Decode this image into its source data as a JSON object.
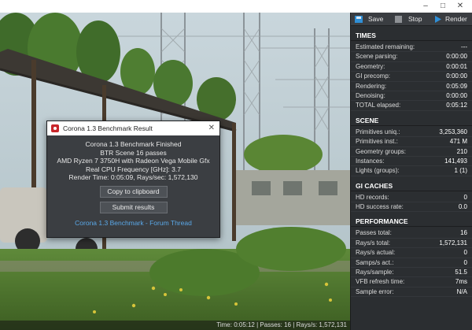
{
  "colors": {
    "panel_bg": "#2b2e31",
    "link": "#5aa8e8",
    "accent_red": "#c8262b",
    "render_blue": "#2f8fd6"
  },
  "toolbar": {
    "save_label": "Save",
    "stop_label": "Stop",
    "render_label": "Render"
  },
  "times": {
    "title": "TIMES",
    "rows": [
      {
        "k": "Estimated remaining:",
        "v": "---"
      },
      {
        "k": "Scene parsing:",
        "v": "0:00:00"
      },
      {
        "k": "Geometry:",
        "v": "0:00:01"
      },
      {
        "k": "GI precomp:",
        "v": "0:00:00"
      },
      {
        "k": "Rendering:",
        "v": "0:05:09"
      },
      {
        "k": "Denoising:",
        "v": "0:00:00"
      },
      {
        "k": "TOTAL elapsed:",
        "v": "0:05:12"
      }
    ]
  },
  "scene": {
    "title": "SCENE",
    "rows": [
      {
        "k": "Primitives uniq.:",
        "v": "3,253,360"
      },
      {
        "k": "Primitives inst.:",
        "v": "471 M"
      },
      {
        "k": "Geometry groups:",
        "v": "210"
      },
      {
        "k": "Instances:",
        "v": "141,493"
      },
      {
        "k": "Lights (groups):",
        "v": "1 (1)"
      }
    ]
  },
  "gi_caches": {
    "title": "GI CACHES",
    "rows": [
      {
        "k": "HD records:",
        "v": "0"
      },
      {
        "k": "HD success rate:",
        "v": "0.0"
      }
    ]
  },
  "performance": {
    "title": "PERFORMANCE",
    "rows": [
      {
        "k": "Passes total:",
        "v": "16"
      },
      {
        "k": "Rays/s total:",
        "v": "1,572,131"
      },
      {
        "k": "Rays/s actual:",
        "v": "0"
      },
      {
        "k": "Samps/s act.:",
        "v": "0"
      },
      {
        "k": "Rays/sample:",
        "v": "51.5"
      },
      {
        "k": "VFB refresh time:",
        "v": "7ms"
      },
      {
        "k": "Sample error:",
        "v": "N/A"
      }
    ]
  },
  "dialog": {
    "title": "Corona 1.3 Benchmark Result",
    "lines": [
      "Corona 1.3 Benchmark Finished",
      "BTR Scene 16 passes",
      "AMD Ryzen 7 3750H with Radeon Vega Mobile Gfx",
      "Real CPU Frequency [GHz]: 3.7",
      "Render Time: 0:05:09, Rays/sec: 1,572,130"
    ],
    "copy_label": "Copy to clipboard",
    "submit_label": "Submit results",
    "link": "Corona 1.3 Benchmark - Forum Thread"
  },
  "statusbar": "Time: 0:05:12 | Passes: 16 | Rays/s: 1,572,131"
}
